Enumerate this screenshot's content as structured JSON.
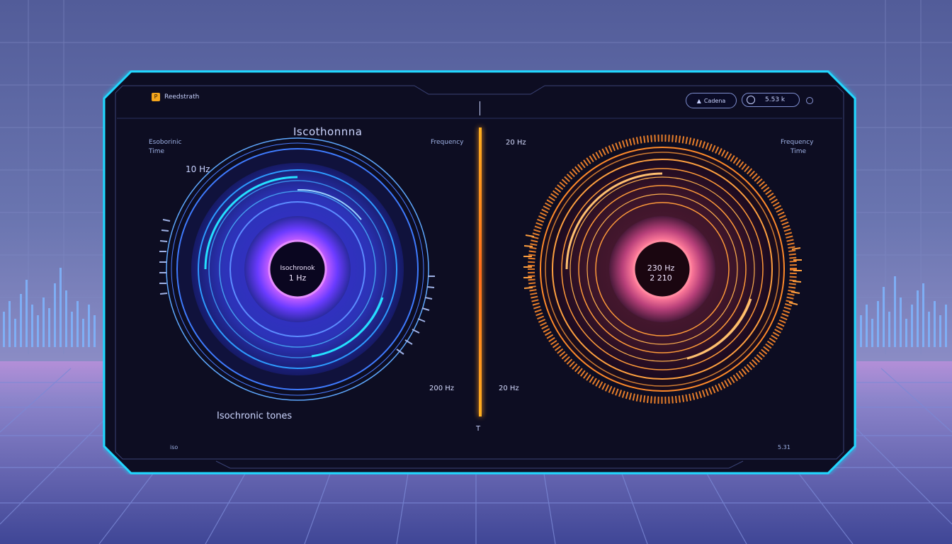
{
  "header": {
    "app_name": "Reedstrath",
    "mode_button": "Cadena",
    "readout": "5.53 k"
  },
  "left_panel": {
    "corner_label_line1": "Esoborinic",
    "corner_label_line2": "Time",
    "title": "Iscothonnna",
    "scale_label": "10 Hz",
    "top_right_label": "Frequency",
    "center_line1": "Isochronok",
    "center_line2": "1 Hz",
    "bottom_label": "200 Hz",
    "footer_title": "Isochronic tones",
    "footer_small": "iso"
  },
  "right_panel": {
    "top_left_label": "20 Hz",
    "corner_label_line1": "Frequency",
    "corner_label_line2": "Time",
    "center_line1": "230 Hz",
    "center_line2": "2 210",
    "bottom_label": "20 Hz",
    "footer_small": "5.31"
  },
  "colors": {
    "frame": "#23d7ff",
    "left_accent": "#8a3dff",
    "left_ring": "#3f7bff",
    "right_accent": "#ff8a2a",
    "divider": "#ff9a1f"
  },
  "icons": {
    "app_logo": "folder-icon",
    "mode_icon": "triangle-icon",
    "readout_icon": "target-icon"
  }
}
